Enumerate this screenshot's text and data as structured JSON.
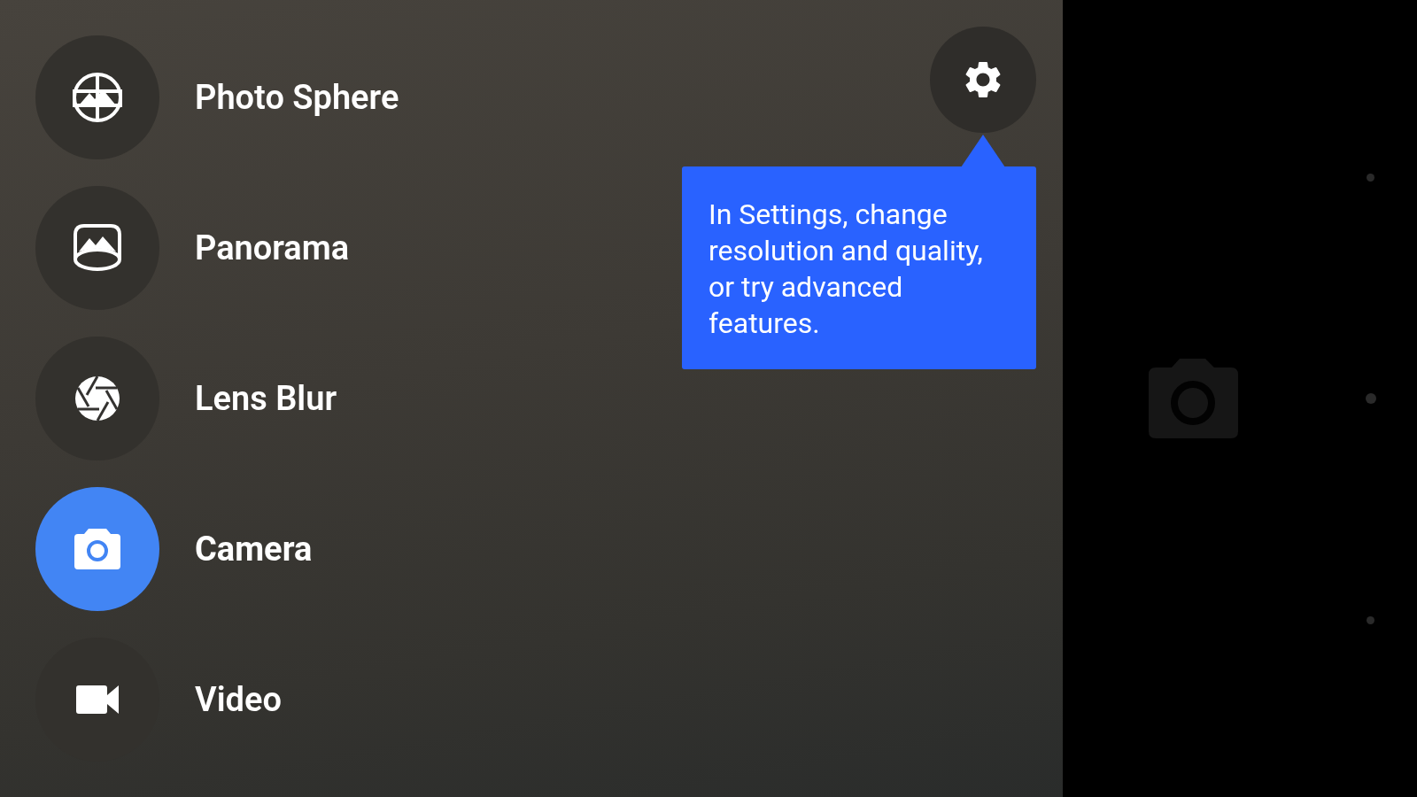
{
  "modes": [
    {
      "kind": "photosphere",
      "label": "Photo Sphere",
      "selected": false
    },
    {
      "kind": "panorama",
      "label": "Panorama",
      "selected": false
    },
    {
      "kind": "lensblur",
      "label": "Lens Blur",
      "selected": false
    },
    {
      "kind": "camera",
      "label": "Camera",
      "selected": true
    },
    {
      "kind": "video",
      "label": "Video",
      "selected": false
    }
  ],
  "tooltip": {
    "text": "In Settings, change resolution and quality, or try advanced features."
  }
}
